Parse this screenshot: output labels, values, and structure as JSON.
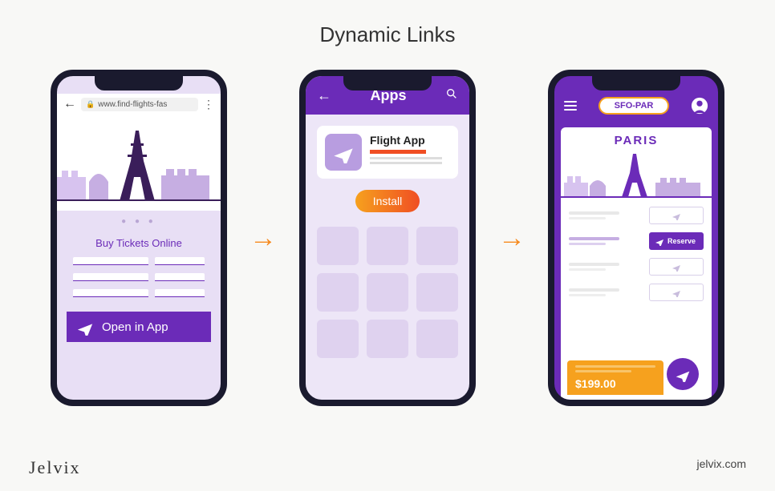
{
  "title": "Dynamic Links",
  "branding": {
    "logo": "Jelvix",
    "site": "jelvix.com"
  },
  "arrows": {
    "glyph": "→"
  },
  "phone1": {
    "url": "www.find-flights-fas",
    "pager": "● ● ●",
    "subtitle": "Buy Tickets Online",
    "cta": "Open in App"
  },
  "phone2": {
    "header": "Apps",
    "app_name": "Flight App",
    "install": "Install"
  },
  "phone3": {
    "route_pill": "SFO-PAR",
    "destination": "PARIS",
    "reserve": "Reserve",
    "price": "$199.00"
  }
}
